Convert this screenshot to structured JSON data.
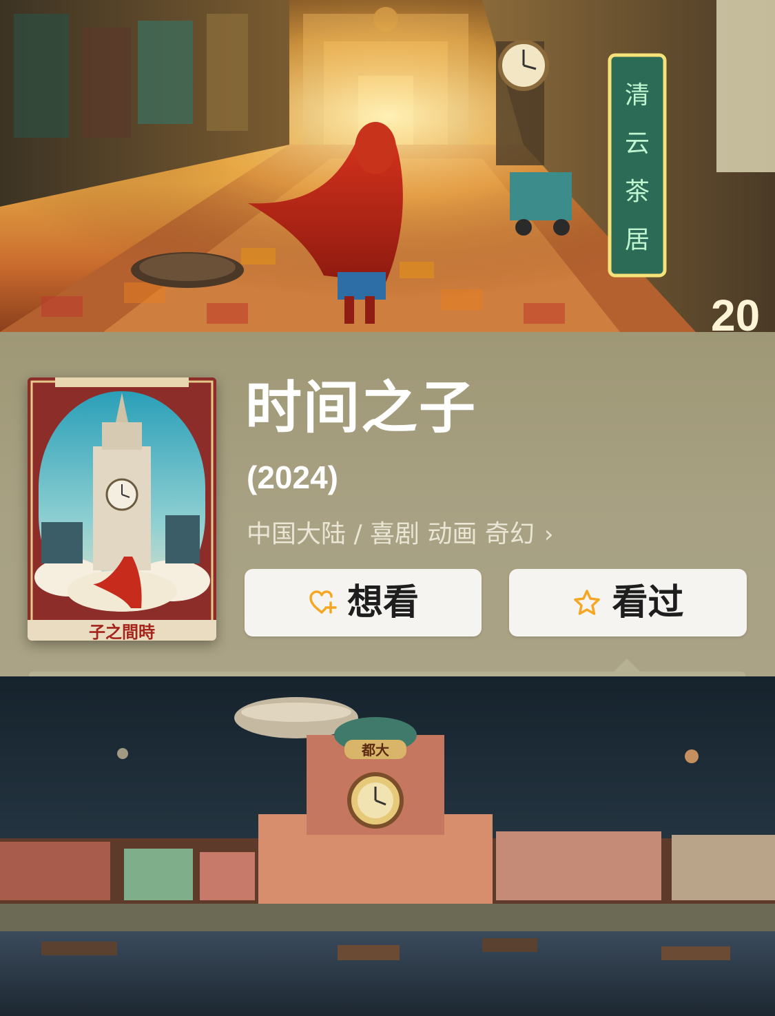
{
  "hero": {
    "image": "hero-street-artwork",
    "corner_text": "20"
  },
  "poster": {
    "image": "movie-poster",
    "top_banner_text": "",
    "bottom_title_text": "子之間時"
  },
  "movie": {
    "title": "时间之子",
    "year": "(2024)",
    "meta": "中国大陆 / 喜剧 动画 奇幻",
    "meta_chevron": "›"
  },
  "actions": {
    "want": {
      "label": "想看",
      "icon": "heart-plus-icon"
    },
    "seen": {
      "label": "看过",
      "icon": "star-outline-icon"
    }
  },
  "still": {
    "image": "city-waterfront-still",
    "sign_text": "都大"
  },
  "colors": {
    "panel_bg": "#a39d7c",
    "button_bg": "#f5f4f0",
    "accent_orange": "#f5a623",
    "title_white": "#ffffff",
    "meta_text": "#e9e6d6"
  }
}
